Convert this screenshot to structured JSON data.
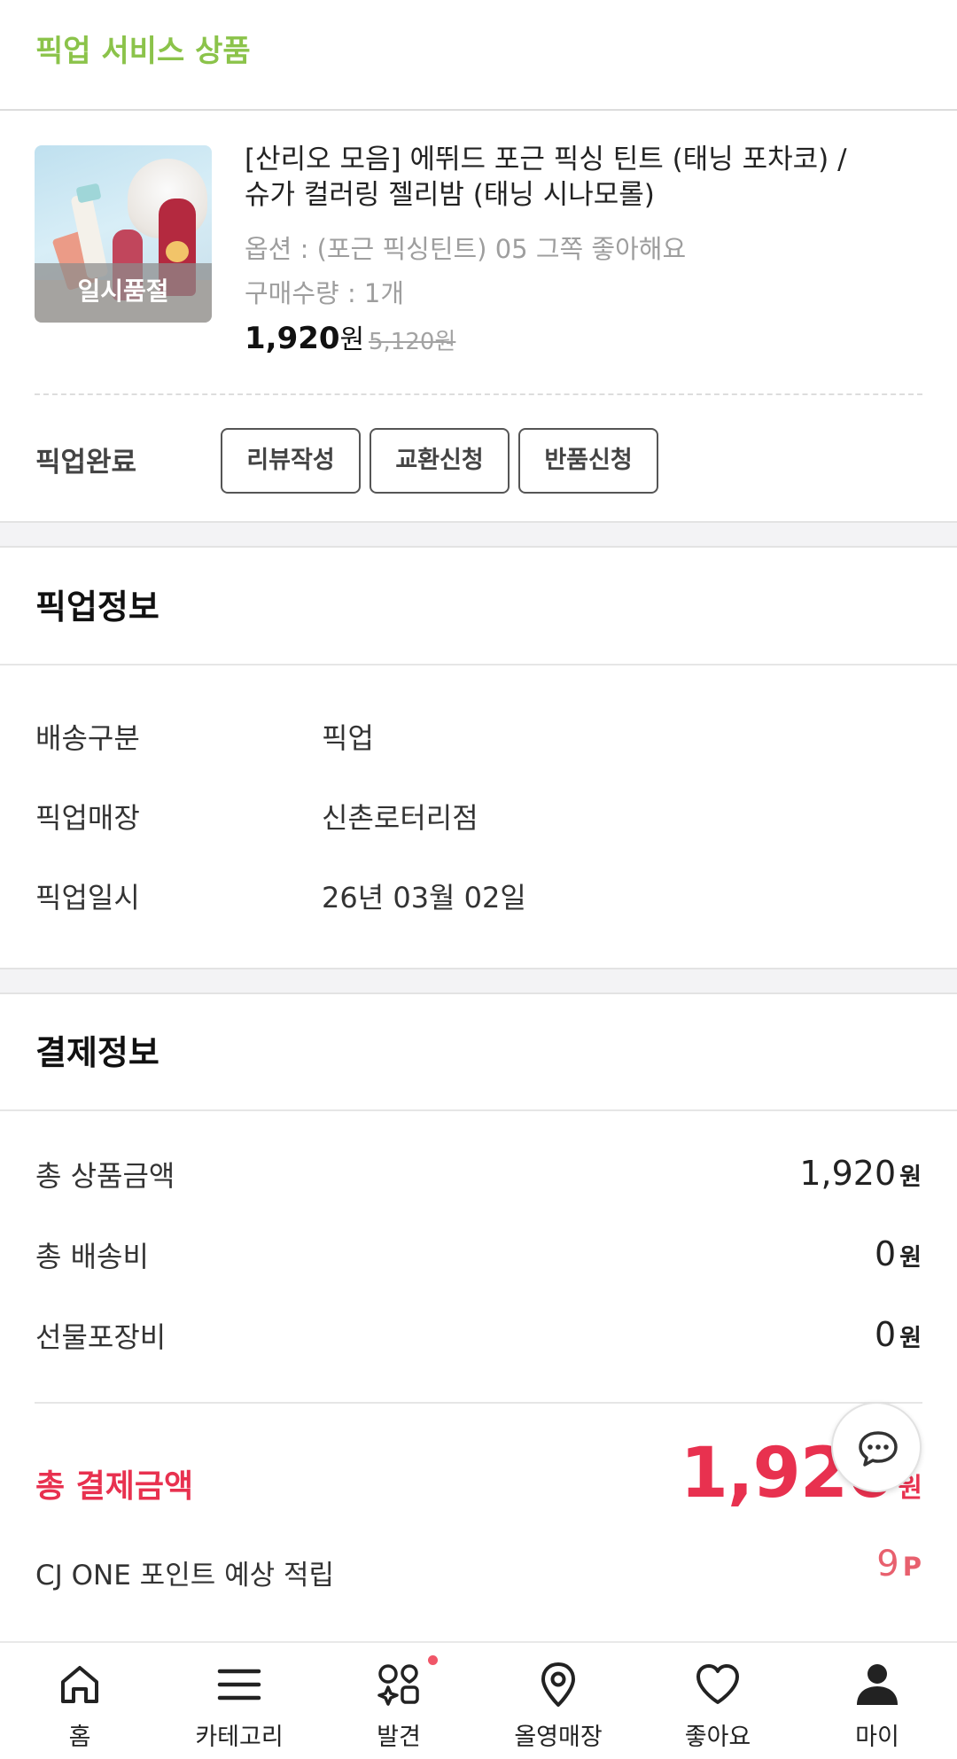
{
  "header": {
    "title": "픽업 서비스 상품"
  },
  "product": {
    "soldout_badge": "일시품절",
    "name": "[산리오 모음] 에뛰드 포근 픽싱 틴트 (태닝 포차코) / 슈가 컬러링 젤리밤 (태닝 시나모롤)",
    "option": "옵션 : (포근 픽싱틴트) 05 그쪽 좋아해요",
    "quantity": "구매수량 : 1개",
    "price": "1,920",
    "price_unit": "원",
    "original_price": "5,120원"
  },
  "status": {
    "label": "픽업완료",
    "buttons": {
      "review": "리뷰작성",
      "exchange": "교환신청",
      "return": "반품신청"
    }
  },
  "pickup_info": {
    "title": "픽업정보",
    "rows": [
      {
        "label": "배송구분",
        "value": "픽업"
      },
      {
        "label": "픽업매장",
        "value": "신촌로터리점"
      },
      {
        "label": "픽업일시",
        "value": "26년 03월 02일"
      }
    ]
  },
  "payment_info": {
    "title": "결제정보",
    "rows": [
      {
        "label": "총 상품금액",
        "value": "1,920",
        "unit": "원"
      },
      {
        "label": "총 배송비",
        "value": "0",
        "unit": "원"
      },
      {
        "label": "선물포장비",
        "value": "0",
        "unit": "원"
      }
    ],
    "total_label": "총 결제금액",
    "total_value": "1,920",
    "total_unit": "원",
    "cj_label": "CJ ONE 포인트 예상 적립",
    "cj_value": "9",
    "cj_unit": "P"
  },
  "tabbar": {
    "items": [
      {
        "label": "홈",
        "icon": "home-icon"
      },
      {
        "label": "카테고리",
        "icon": "menu-icon"
      },
      {
        "label": "발견",
        "icon": "discover-icon"
      },
      {
        "label": "올영매장",
        "icon": "location-pin-icon"
      },
      {
        "label": "좋아요",
        "icon": "heart-icon"
      },
      {
        "label": "마이",
        "icon": "person-icon"
      }
    ]
  },
  "colors": {
    "accent_green": "#8bc34a",
    "accent_red": "#e8314f",
    "point_red": "#e8606e",
    "notification_dot": "#f05668"
  }
}
